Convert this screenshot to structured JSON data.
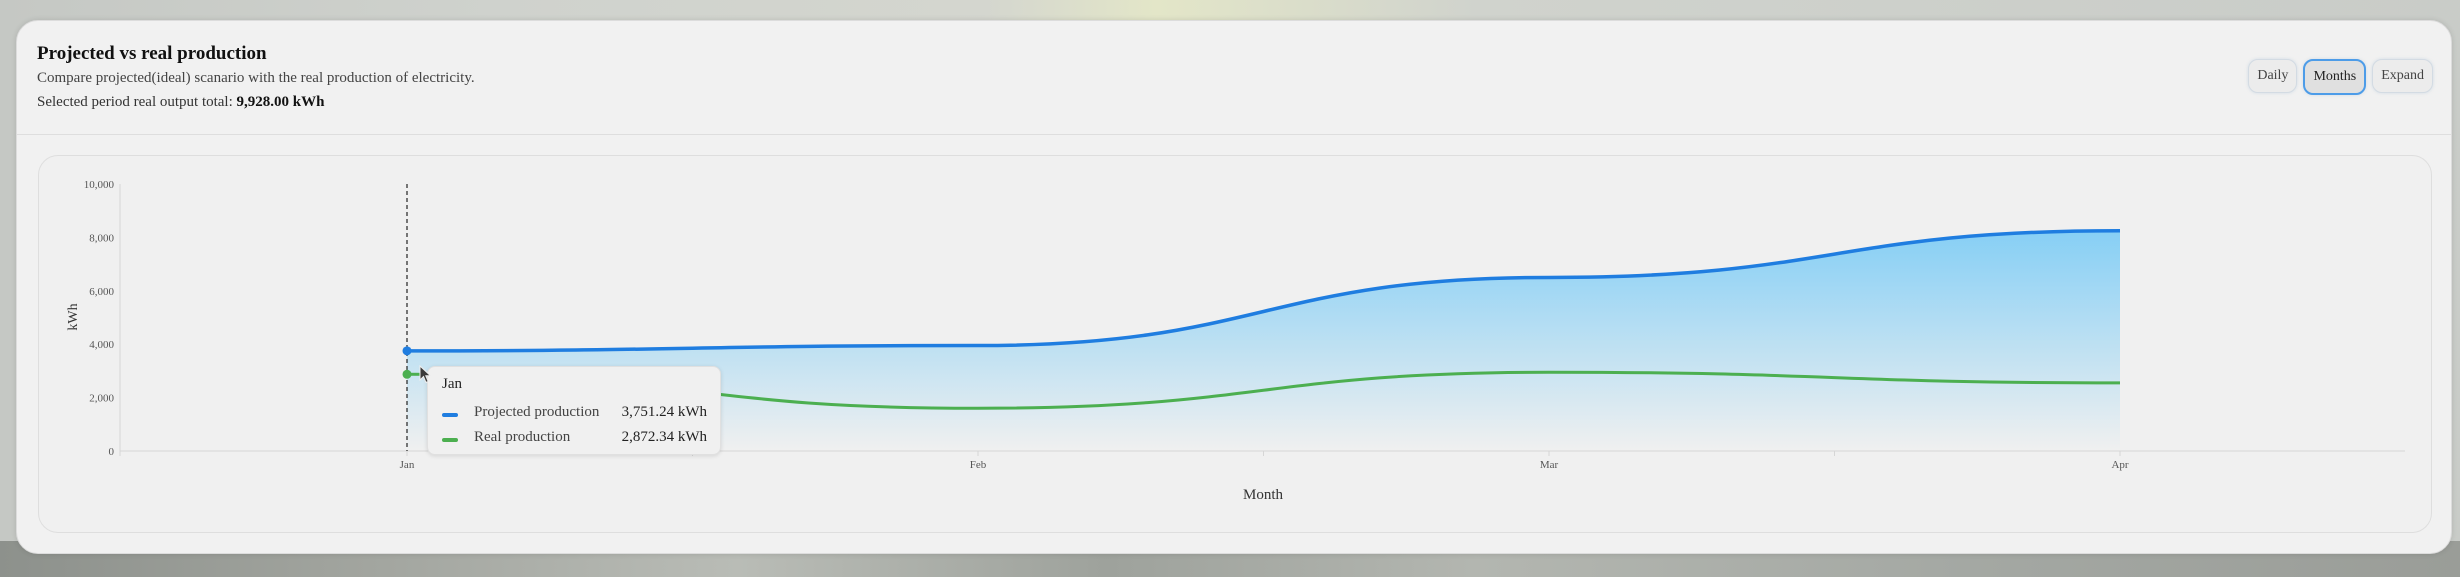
{
  "header": {
    "title": "Projected vs real production",
    "subtitle": "Compare projected(ideal) scanario with the real production of electricity.",
    "total_label": "Selected period real output total:",
    "total_value": "9,928.00 kWh"
  },
  "toolbar": {
    "daily_label": "Daily",
    "months_label": "Months",
    "expand_label": "Expand",
    "active": "Months"
  },
  "colors": {
    "projected": "#1f7de0",
    "real": "#4caf50",
    "area_top": "#86cff5",
    "accent": "#4d9ce8"
  },
  "chart_data": {
    "type": "area",
    "xlabel": "Month",
    "ylabel": "kWh",
    "ylim": [
      0,
      10000
    ],
    "yticks": [
      "0",
      "2,000",
      "4,000",
      "6,000",
      "8,000",
      "10,000"
    ],
    "categories": [
      "Jan",
      "Feb",
      "Mar",
      "Apr"
    ],
    "series": [
      {
        "name": "Projected production",
        "values": [
          3751.24,
          3950,
          6500,
          8250
        ]
      },
      {
        "name": "Real production",
        "values": [
          2872.34,
          1600,
          2950,
          2550
        ]
      }
    ],
    "hover_index": 0,
    "grid": false
  },
  "tooltip": {
    "title": "Jan",
    "rows": [
      {
        "name": "Projected production",
        "value": "3,751.24 kWh"
      },
      {
        "name": "Real production",
        "value": "2,872.34 kWh"
      }
    ]
  }
}
